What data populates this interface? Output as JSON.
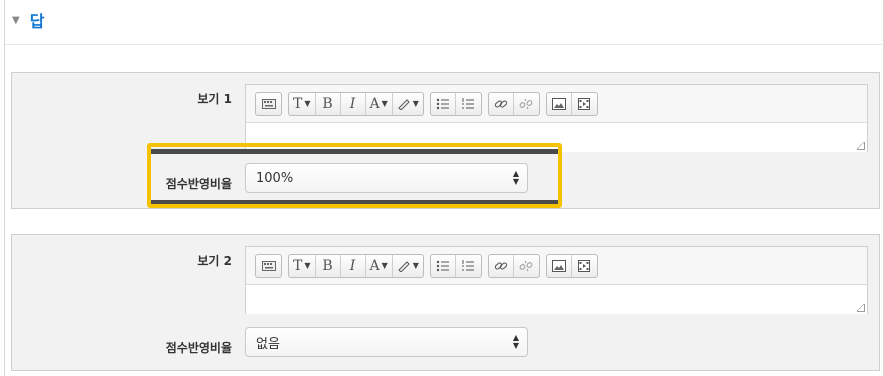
{
  "section": {
    "title": "답",
    "collapse_icon": "triangle-down-icon"
  },
  "choices": [
    {
      "label": "보기 1",
      "grade_label": "점수반영비율",
      "grade_value": "100%"
    },
    {
      "label": "보기 2",
      "grade_label": "점수반영비율",
      "grade_value": "없음"
    }
  ],
  "toolbar": {
    "bold": "B",
    "italic": "I",
    "font_size": "T",
    "font_color": "A"
  },
  "colors": {
    "accent": "#1177d1",
    "highlight": "#f4c200"
  }
}
